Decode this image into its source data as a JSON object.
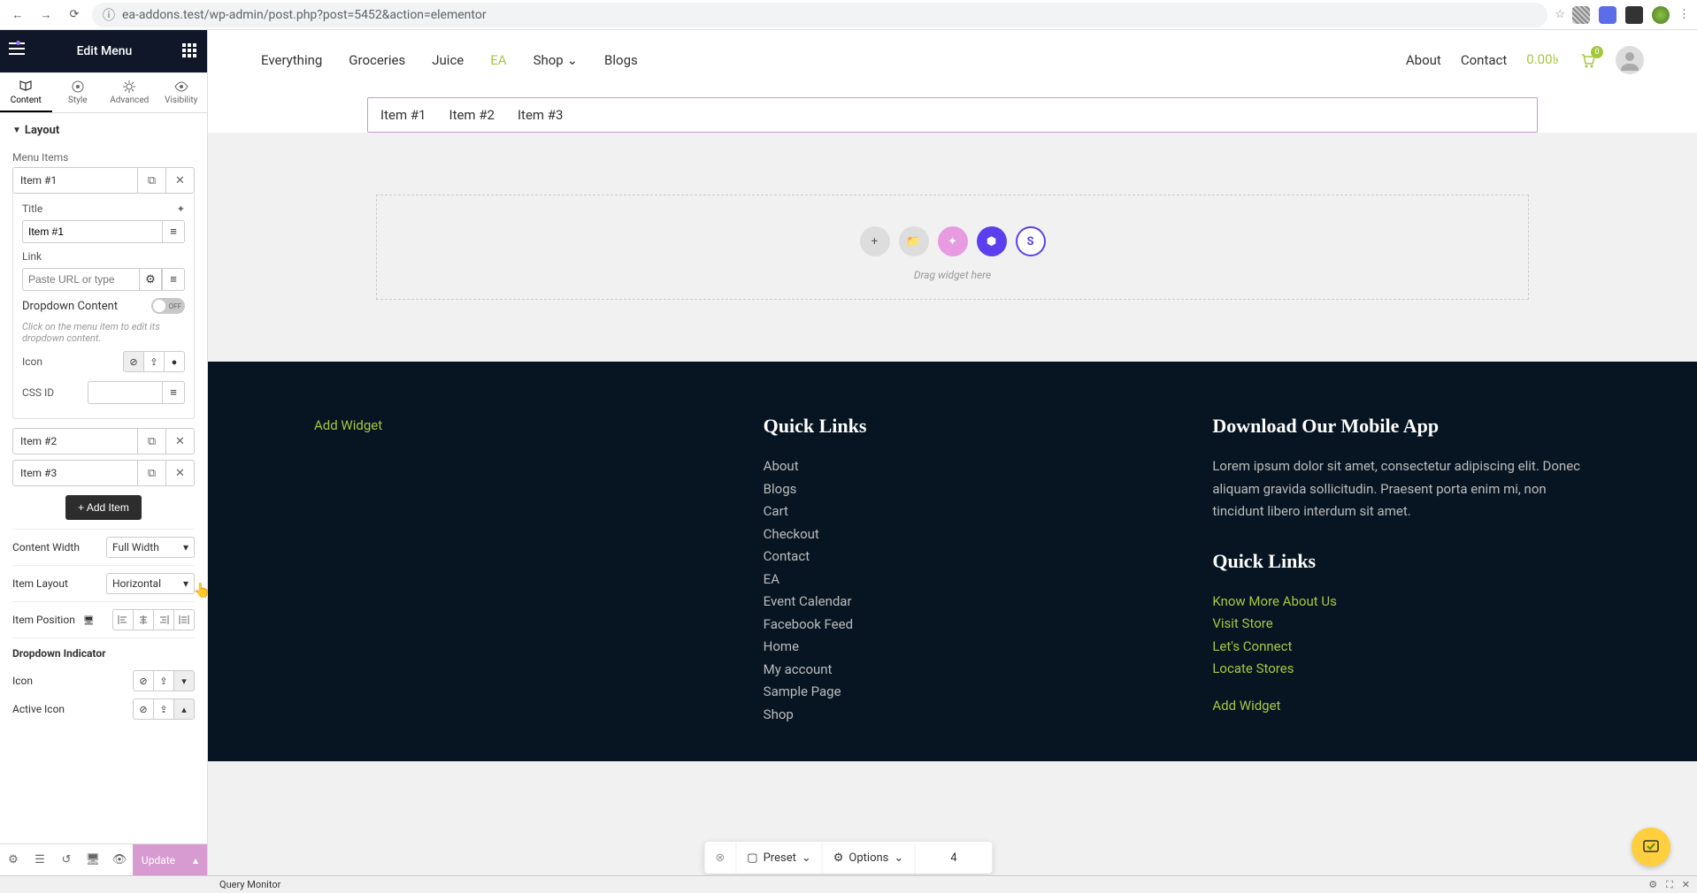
{
  "browser": {
    "url": "ea-addons.test/wp-admin/post.php?post=5452&action=elementor"
  },
  "sidebar": {
    "title": "Edit Menu",
    "tabs": [
      "Content",
      "Style",
      "Advanced",
      "Visibility"
    ],
    "section": "Layout",
    "menu_items_label": "Menu Items",
    "items": [
      {
        "name": "Item #1"
      },
      {
        "name": "Item #2"
      },
      {
        "name": "Item #3"
      }
    ],
    "title_label": "Title",
    "title_value": "Item #1",
    "link_label": "Link",
    "link_placeholder": "Paste URL or type",
    "dropdown_content_label": "Dropdown Content",
    "dropdown_switch": "OFF",
    "dropdown_hint": "Click on the menu item to edit its dropdown content.",
    "icon_label": "Icon",
    "cssid_label": "CSS ID",
    "add_item": "+  Add Item",
    "content_width_label": "Content Width",
    "content_width_value": "Full Width",
    "item_layout_label": "Item Layout",
    "item_layout_value": "Horizontal",
    "item_position_label": "Item Position",
    "dropdown_indicator_label": "Dropdown Indicator",
    "icon2_label": "Icon",
    "active_icon_label": "Active Icon",
    "update": "Update"
  },
  "topnav": {
    "left": [
      "Everything",
      "Groceries",
      "Juice",
      "EA",
      "Shop",
      "Blogs"
    ],
    "right": [
      "About",
      "Contact"
    ],
    "price": "0.00৳",
    "cart_badge": "0"
  },
  "menu_preview": [
    "Item #1",
    "Item #2",
    "Item #3"
  ],
  "dropzone": {
    "text": "Drag widget here"
  },
  "footer": {
    "add_widget": "Add Widget",
    "quick_links_title": "Quick Links",
    "quick_links": [
      "About",
      "Blogs",
      "Cart",
      "Checkout",
      "Contact",
      "EA",
      "Event Calendar",
      "Facebook Feed",
      "Home",
      "My account",
      "Sample Page",
      "Shop"
    ],
    "download_title": "Download Our Mobile App",
    "download_text": "Lorem ipsum dolor sit amet, consectetur adipiscing elit. Donec aliquam gravida sollicitudin. Praesent porta enim mi, non tincidunt libero interdum sit amet.",
    "quick_links2_title": "Quick Links",
    "quick_links2": [
      "Know More About Us",
      "Visit Store",
      "Let's Connect",
      "Locate Stores"
    ],
    "add_widget2": "Add Widget"
  },
  "bottom_toolbar": {
    "preset": "Preset",
    "options": "Options",
    "page": "4"
  },
  "status": {
    "query_monitor": "Query Monitor"
  }
}
